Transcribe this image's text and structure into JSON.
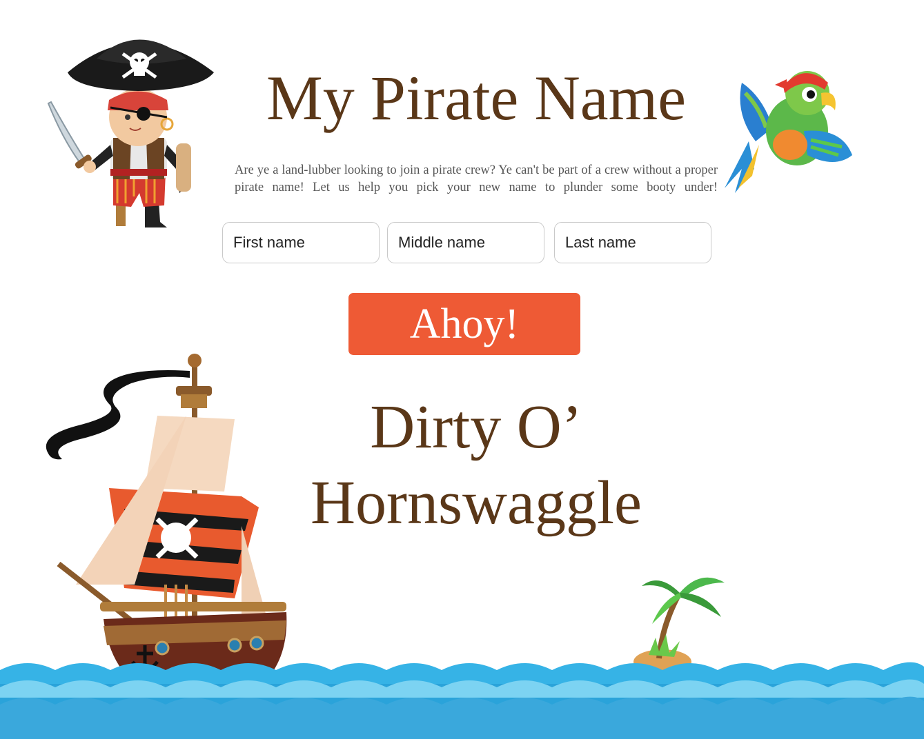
{
  "header": {
    "title": "My Pirate Name",
    "intro": "Are ye a land-lubber looking to join a pirate crew? Ye can't be part of a crew without a proper pirate name! Let us help you pick your new name to plunder some booty under!"
  },
  "form": {
    "first_placeholder": "First name",
    "middle_placeholder": "Middle name",
    "last_placeholder": "Last name",
    "submit_label": "Ahoy!"
  },
  "result": {
    "line1": "Dirty O’",
    "line2": "Hornswaggle"
  },
  "colors": {
    "title": "#5a3718",
    "button": "#ee5a35",
    "sea": "#29a6dc",
    "sea_light": "#7cd3f2"
  },
  "decorations": {
    "pirate_boy": "pirate-boy-illustration",
    "parrot": "parrot-illustration",
    "ship": "pirate-ship-illustration",
    "island": "palm-island-illustration",
    "sea": "sea-waves"
  }
}
